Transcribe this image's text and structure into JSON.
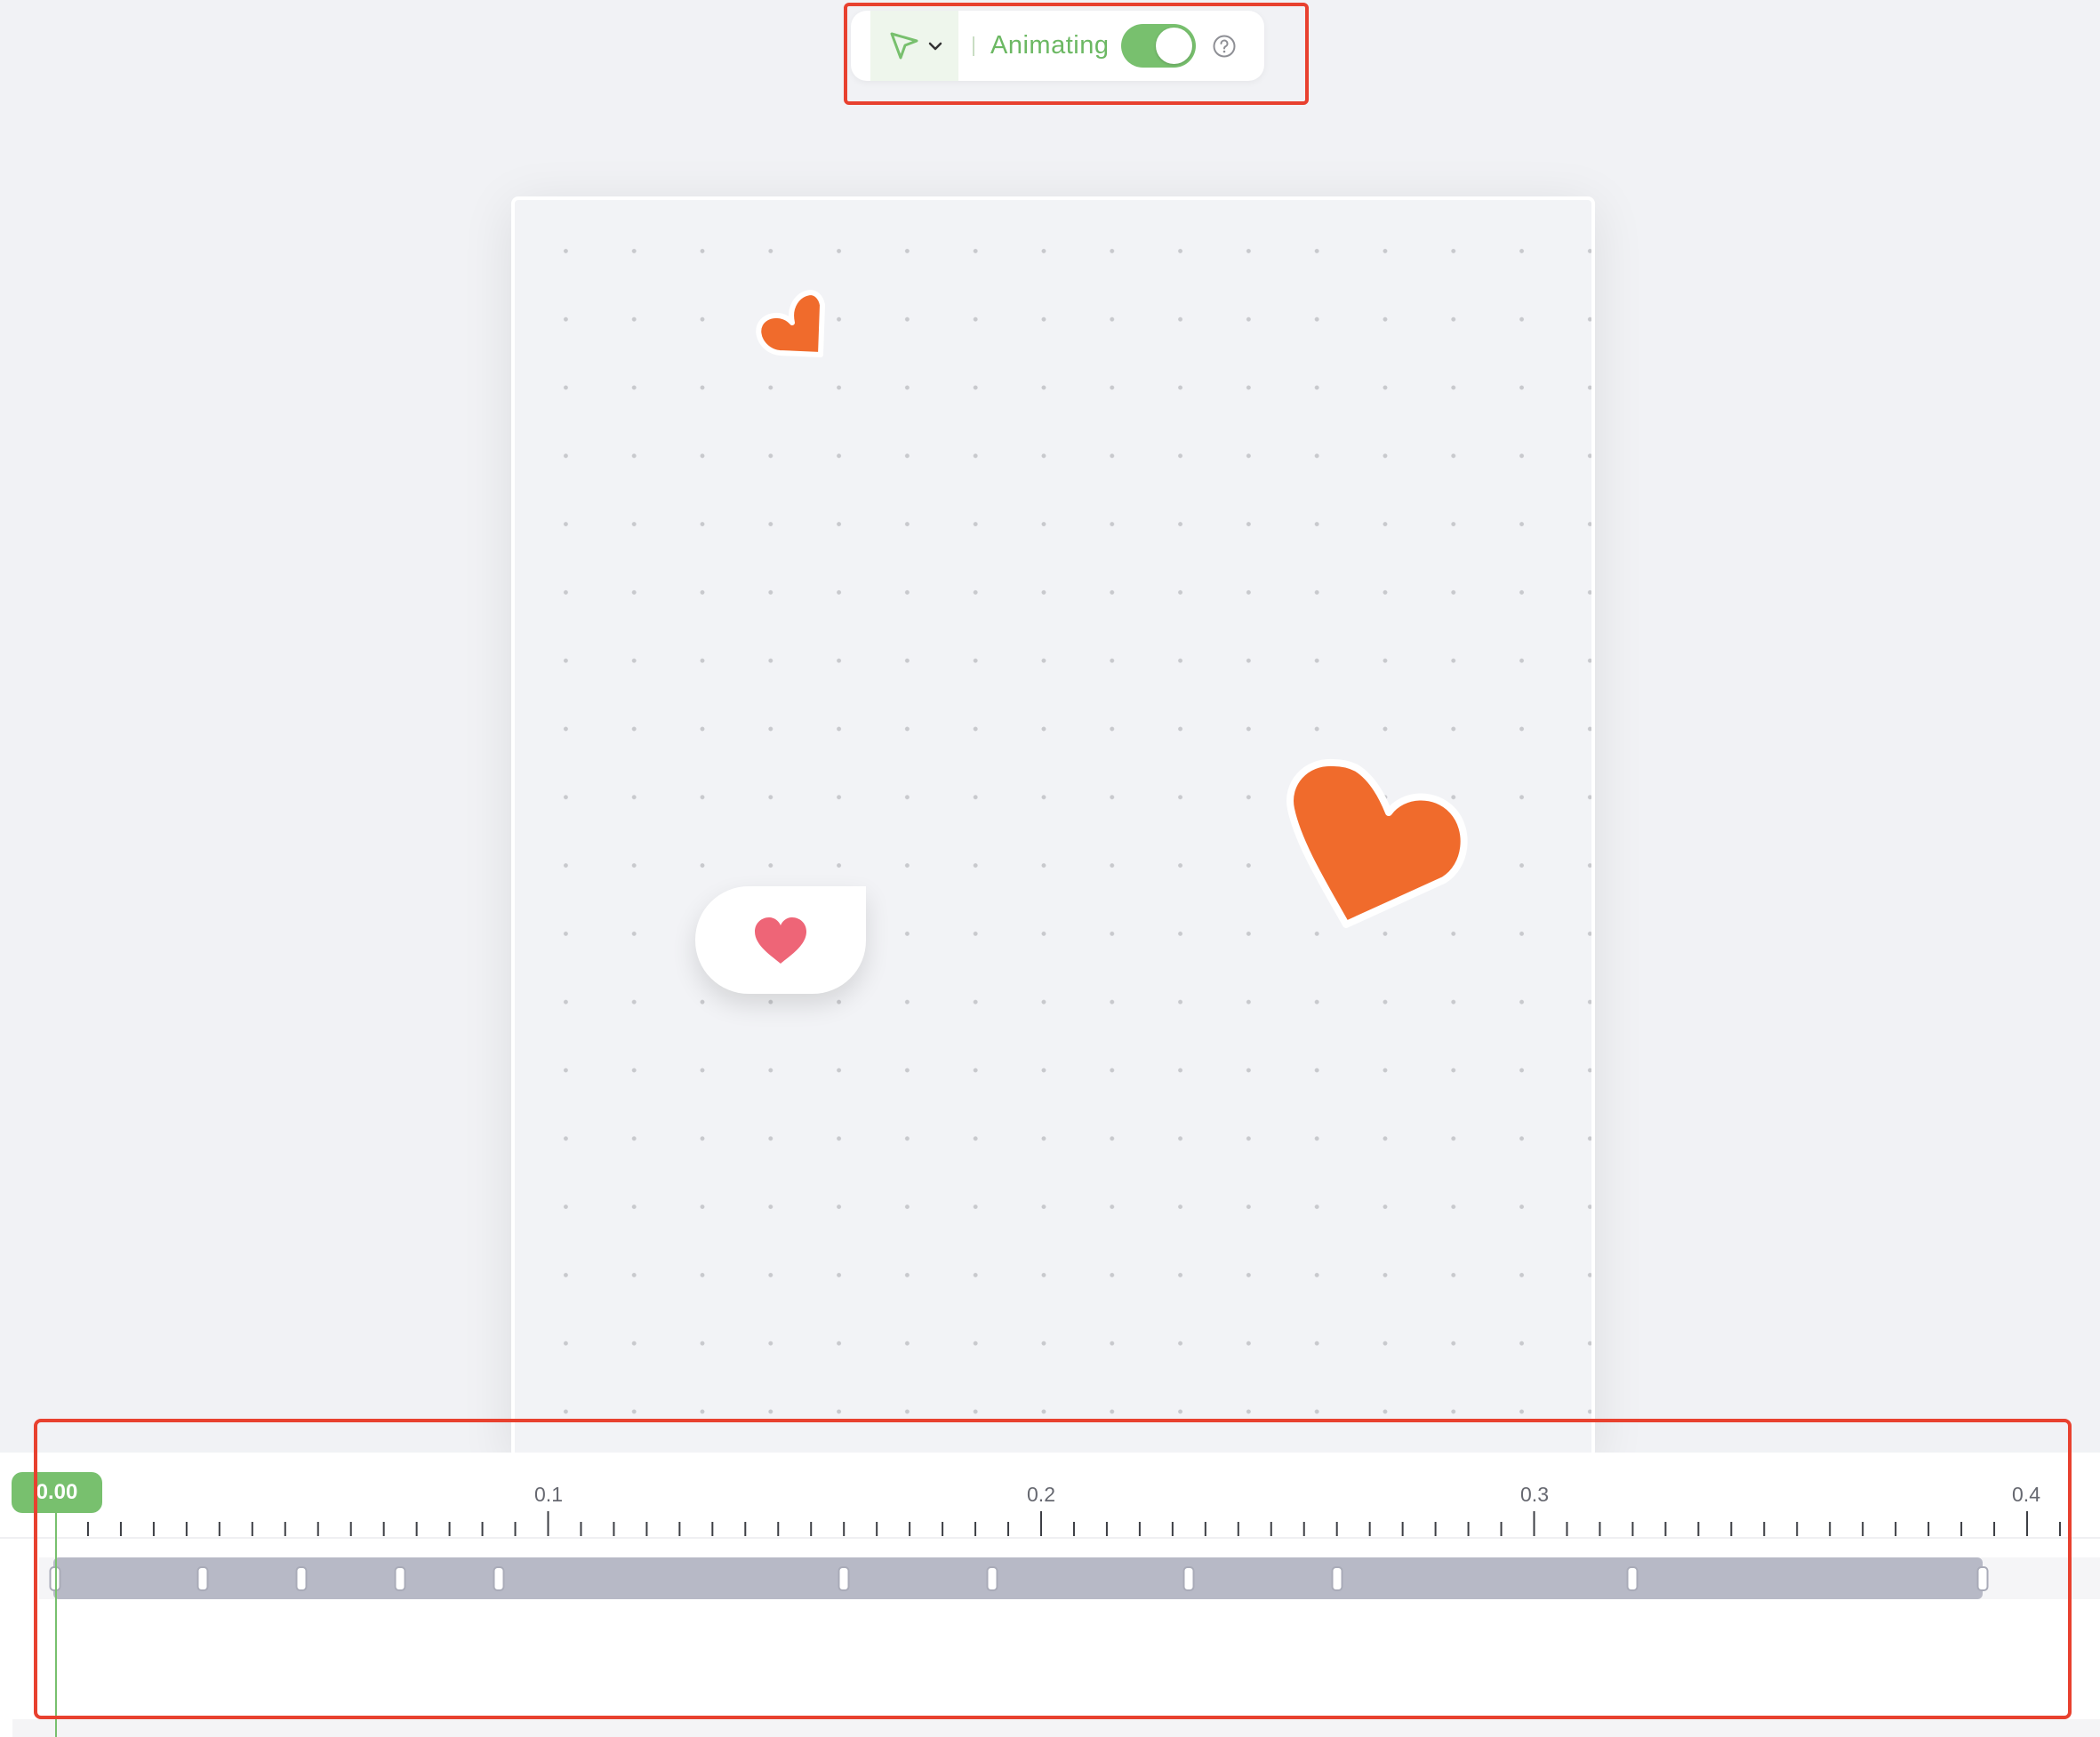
{
  "toolbar": {
    "tool_icon": "pointer-arrow-icon",
    "dropdown_icon": "chevron-down-icon",
    "mode_label": "Animating",
    "toggle_on": true,
    "help_icon": "question-circle-icon",
    "accent_color": "#78c06e"
  },
  "canvas": {
    "background": "dotted-grid",
    "objects": [
      {
        "name": "small-heart",
        "color": "#f06b2c"
      },
      {
        "name": "large-heart",
        "color": "#f06b2c"
      },
      {
        "name": "heart-bubble",
        "heart_color": "#ee6577"
      }
    ]
  },
  "timeline": {
    "playhead_label": "0.00",
    "ruler_labels": [
      "0.1",
      "0.2",
      "0.3",
      "0.4"
    ],
    "ruler_values": [
      0.1,
      0.2,
      0.3,
      0.4
    ],
    "track": {
      "start": 0.0,
      "end": 0.391,
      "color": "#b7b9c6",
      "keyframes": [
        0.0,
        0.03,
        0.05,
        0.07,
        0.09,
        0.16,
        0.19,
        0.23,
        0.26,
        0.32,
        0.391
      ]
    }
  },
  "highlight_color": "#e8412f"
}
